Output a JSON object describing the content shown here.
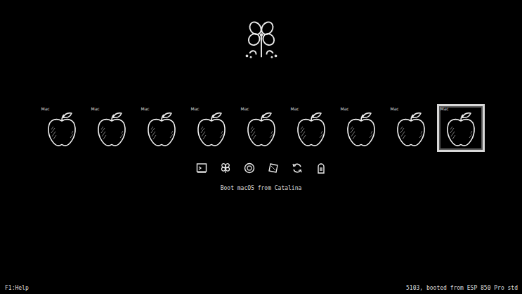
{
  "entries": [
    {
      "badge": "Mac",
      "selected": false
    },
    {
      "badge": "Mac",
      "selected": false
    },
    {
      "badge": "Mac",
      "selected": false
    },
    {
      "badge": "Mac",
      "selected": false
    },
    {
      "badge": "Mac",
      "selected": false
    },
    {
      "badge": "Mac",
      "selected": false
    },
    {
      "badge": "Mac",
      "selected": false
    },
    {
      "badge": "Mac",
      "selected": false
    },
    {
      "badge": "Mac",
      "selected": true
    }
  ],
  "tools": [
    {
      "kind": "shell",
      "selected": false
    },
    {
      "kind": "clover",
      "selected": false
    },
    {
      "kind": "disk",
      "selected": false
    },
    {
      "kind": "reset",
      "selected": false
    },
    {
      "kind": "reload",
      "selected": false
    },
    {
      "kind": "shutdown",
      "selected": false
    }
  ],
  "selection_label": "Boot macOS from Catalina",
  "footer": {
    "help": "F1:Help",
    "status": "5103, booted from ESP 850 Pro std"
  }
}
